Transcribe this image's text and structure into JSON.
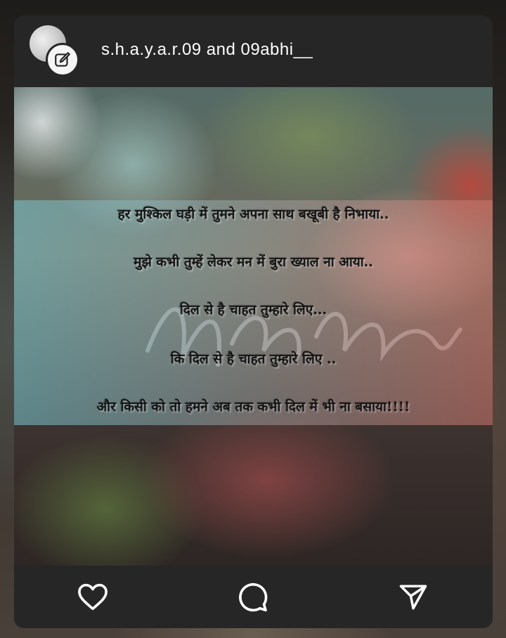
{
  "post": {
    "username": "s.h.a.y.a.r.09 and 09abhi__",
    "avatar_icon": "avatar",
    "badge_icon": "edit-icon"
  },
  "poem": {
    "lines": [
      "हर मुश्किल घड़ी में तुमने अपना साथ बखूबी है निभाया..",
      "मुझे कभी तुम्हें लेकर मन में बुरा ख्याल ना आया..",
      "दिल से है चाहत तुम्हारे लिए...",
      "कि दिल से है चाहत तुम्हारे लिए ..",
      "और किसी को तो हमने अब तक कभी दिल में भी ना बसाया!!!!"
    ]
  },
  "actions": {
    "like_icon": "heart-icon",
    "comment_icon": "comment-icon",
    "share_icon": "send-icon"
  }
}
